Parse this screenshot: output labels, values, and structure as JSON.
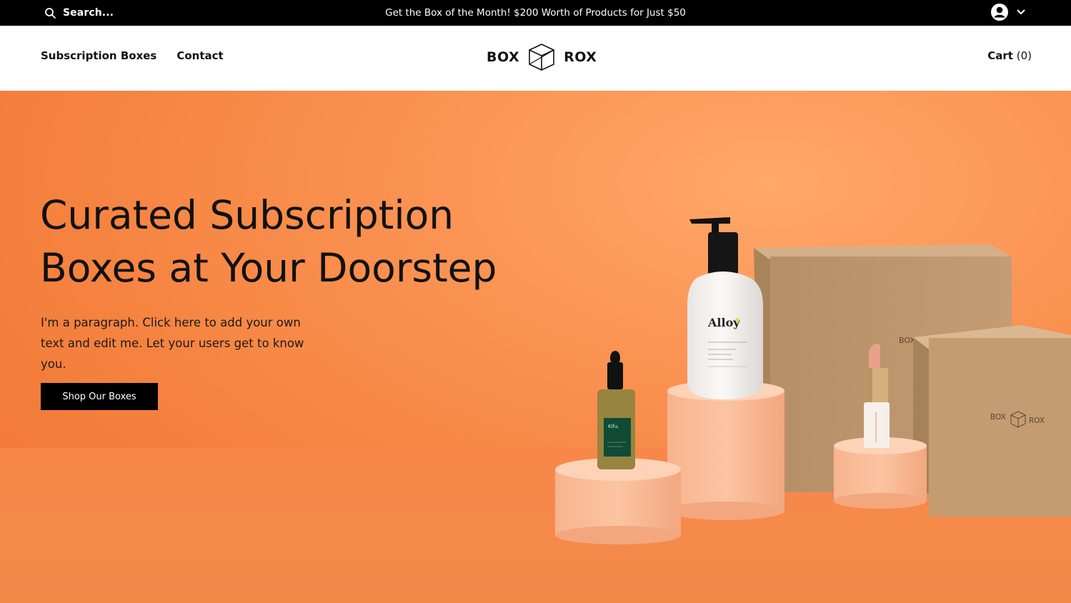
{
  "topbar": {
    "search_placeholder": "Search...",
    "promo": "Get the Box of the Month! $200 Worth of Products for Just $50"
  },
  "header": {
    "nav": [
      "Subscription Boxes",
      "Contact"
    ],
    "logo_left": "BOX",
    "logo_right": "ROX",
    "cart_label": "Cart",
    "cart_count": "(0)"
  },
  "hero": {
    "title": "Curated Subscription Boxes at Your Doorstep",
    "paragraph": "I'm a paragraph. Click here to add your own text and edit me. Let your users get to know you.",
    "button": "Shop Our Boxes",
    "product_labels": {
      "lotion_brand": "Alloy",
      "serum_brand": "Kifu.",
      "box_logo_left": "BOX",
      "box_logo_right": "ROX",
      "box_logo_partial": "BOX"
    }
  },
  "colors": {
    "hero_orange": "#f5823f",
    "topbar": "#000000",
    "button_bg": "#000000"
  },
  "icons": {
    "search": "search-icon",
    "account": "user-avatar-icon",
    "chevron": "chevron-down-icon",
    "logo": "cube-logo-icon"
  }
}
